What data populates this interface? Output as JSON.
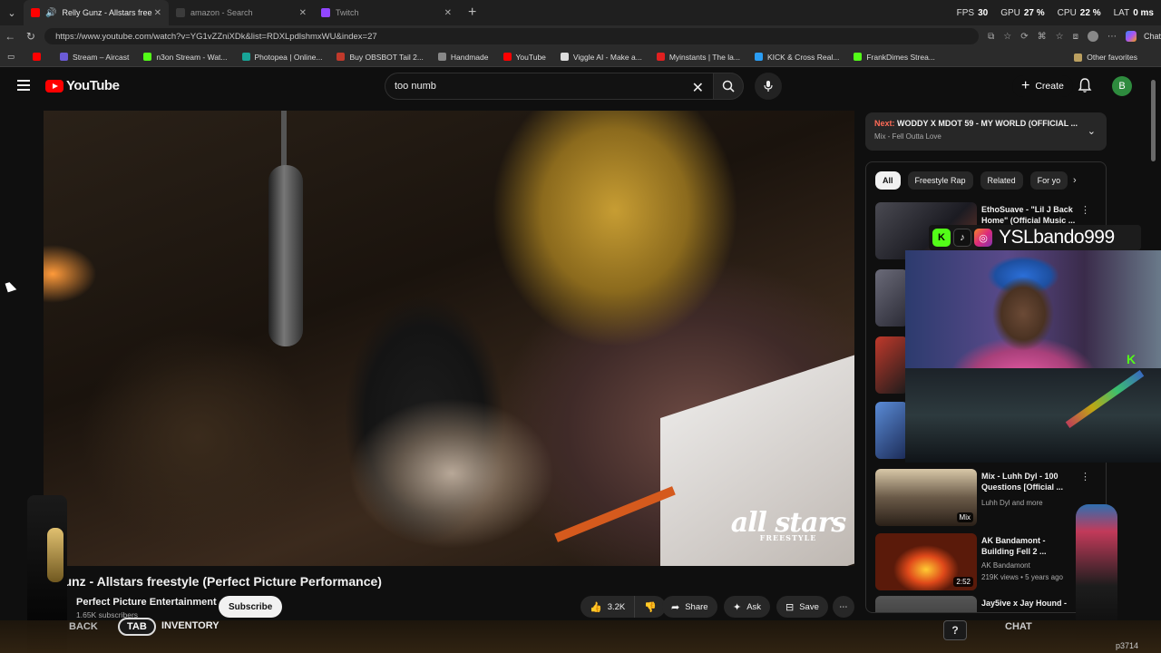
{
  "browser": {
    "tabs": [
      {
        "title": "Relly Gunz - Allstars freestyle",
        "active": true,
        "icon": "youtube-icon",
        "color": "#ff0000"
      },
      {
        "title": "amazon - Search",
        "active": false,
        "icon": "search-icon",
        "color": "#3b3b3b"
      },
      {
        "title": "Twitch",
        "active": false,
        "icon": "twitch-icon",
        "color": "#9146ff"
      }
    ],
    "stats": [
      {
        "label": "FPS",
        "value": "30"
      },
      {
        "label": "GPU",
        "value": "27 %"
      },
      {
        "label": "CPU",
        "value": "22 %"
      },
      {
        "label": "LAT",
        "value": "0 ms"
      }
    ],
    "url": "https://www.youtube.com/watch?v=YG1vZZniXDk&list=RDXLpdlshmxWU&index=27",
    "chat_label": "Chat",
    "bookmarks": [
      {
        "label": "",
        "color": "#ff0000"
      },
      {
        "label": "Stream – Aircast",
        "color": "#6b5bd6"
      },
      {
        "label": "n3on Stream - Wat...",
        "color": "#53fc18"
      },
      {
        "label": "Photopea | Online...",
        "color": "#18a497"
      },
      {
        "label": "Buy OBSBOT Tail 2...",
        "color": "#c0392b"
      },
      {
        "label": "Handmade",
        "color": "#888888"
      },
      {
        "label": "YouTube",
        "color": "#ff0000"
      },
      {
        "label": "Viggle AI - Make a...",
        "color": "#dddddd"
      },
      {
        "label": "Myinstants | The la...",
        "color": "#e02020"
      },
      {
        "label": "KICK & Cross Real...",
        "color": "#2a9df4"
      },
      {
        "label": "FrankDimes Strea...",
        "color": "#53fc18"
      }
    ],
    "other_favorites": "Other favorites"
  },
  "youtube": {
    "logo_text": "YouTube",
    "search_value": "too numb",
    "create_label": "Create",
    "avatar_letter": "B"
  },
  "video": {
    "watermark_big": "all stars",
    "watermark_small": "FREESTYLE",
    "title": "y Gunz - Allstars freestyle (Perfect Picture Performance)",
    "channel": "Perfect Picture Entertainment",
    "subscribers": "1.65K subscribers",
    "subscribe_label": "Subscribe",
    "likes": "3.2K",
    "share_label": "Share",
    "ask_label": "Ask",
    "save_label": "Save"
  },
  "sidebar": {
    "next_label": "Next:",
    "next_title": "WODDY X MDOT 59 - MY WORLD (OFFICIAL ...",
    "next_sub": "Mix - Fell Outta Love",
    "chips": [
      "All",
      "Freestyle Rap",
      "Related",
      "For yo"
    ],
    "recs": [
      {
        "title": "EthoSuave - \"Lil J Back Home\" (Official Music ...",
        "meta": [],
        "duration": ""
      },
      {
        "title": "Mix - Luhh Dyl - 100 Questions [Official ...",
        "meta": [
          "Luhh Dyl and more"
        ],
        "duration": "Mix"
      },
      {
        "title": "AK Bandamont - Building Fell 2 ...",
        "meta": [
          "AK Bandamont",
          "219K views • 5 years ago"
        ],
        "duration": "2:52"
      },
      {
        "title": "Jay5ive x Jay Hound -",
        "meta": [],
        "duration": ""
      }
    ]
  },
  "overlay": {
    "handle": "YSLbando999",
    "back_label": "BACK",
    "tab_key": "TAB",
    "inventory_label": "INVENTORY",
    "help_key": "?",
    "chat_label": "CHAT",
    "corner_label": "p3714"
  }
}
